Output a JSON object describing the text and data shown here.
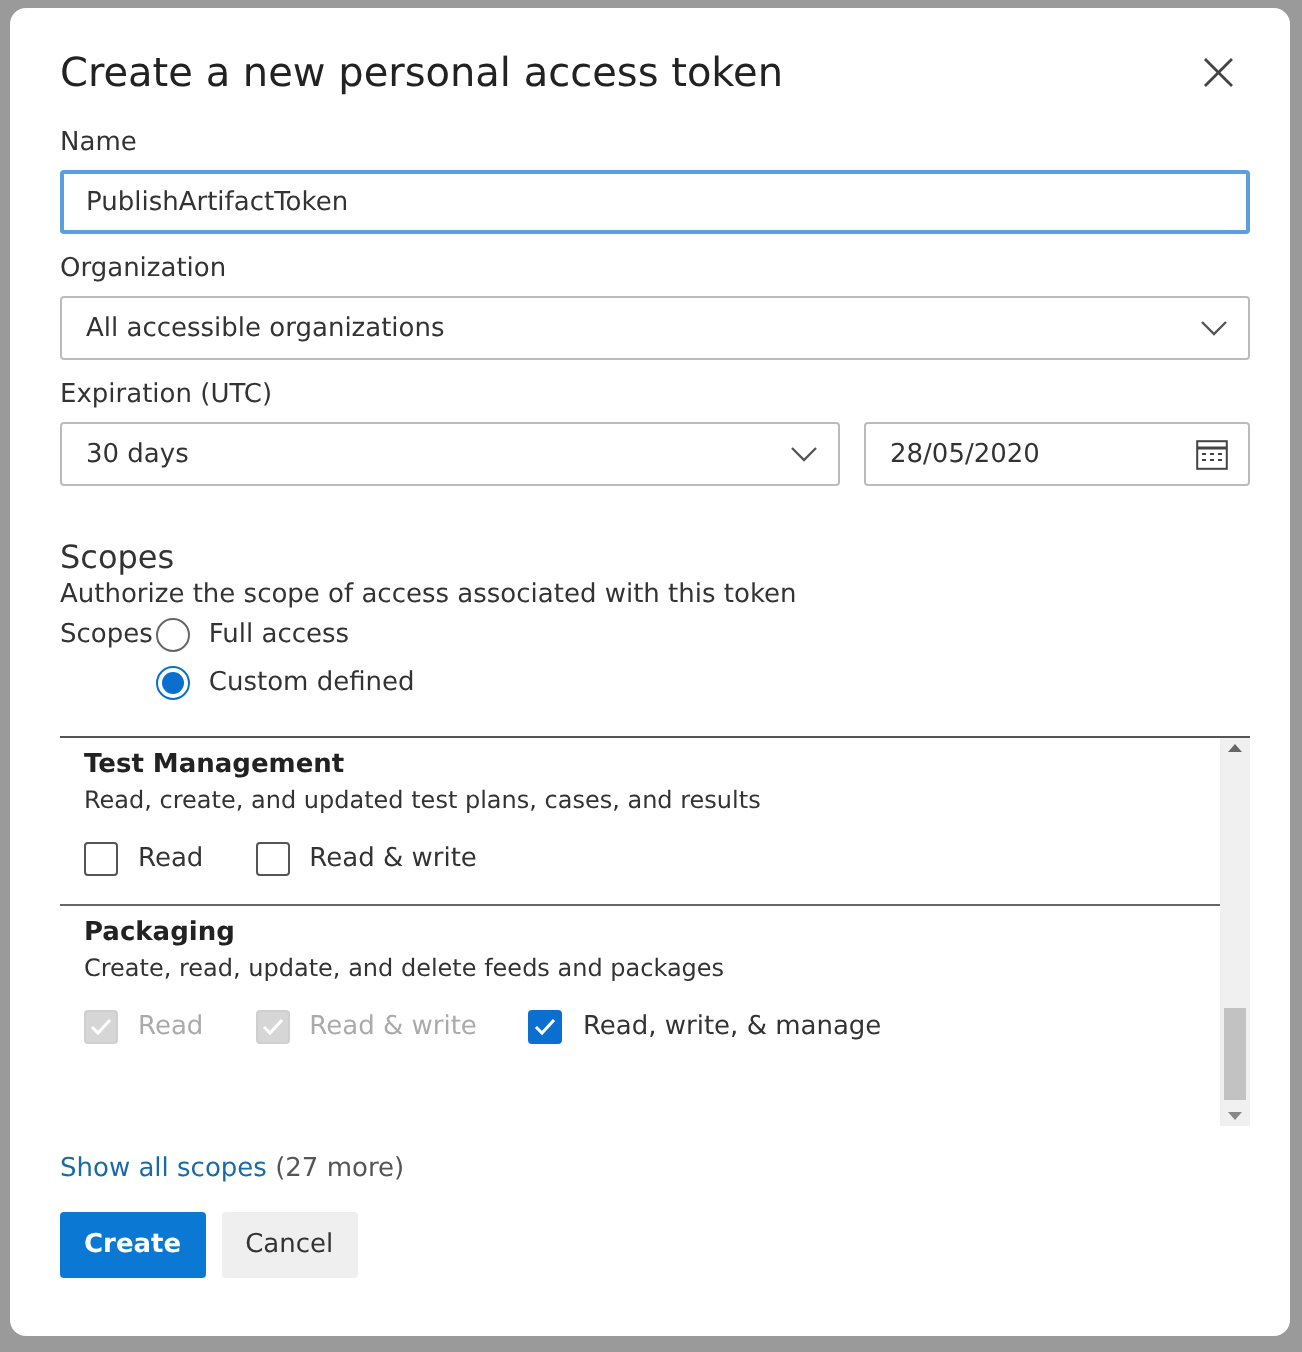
{
  "dialog": {
    "title": "Create a new personal access token",
    "close": "×"
  },
  "name": {
    "label": "Name",
    "value": "PublishArtifactToken",
    "focused": true
  },
  "organization": {
    "label": "Organization",
    "value": "All accessible organizations"
  },
  "expiration": {
    "label": "Expiration (UTC)",
    "value": "30 days",
    "date": "28/05/2020"
  },
  "scopes": {
    "heading": "Scopes",
    "description": "Authorize the scope of access associated with this token",
    "group_label": "Scopes",
    "options": [
      {
        "label": "Full access",
        "selected": false
      },
      {
        "label": "Custom defined",
        "selected": true
      }
    ],
    "sections": [
      {
        "title": "Test Management",
        "description": "Read, create, and updated test plans, cases, and results",
        "permissions": [
          {
            "label": "Read",
            "checked": false,
            "disabled": false
          },
          {
            "label": "Read & write",
            "checked": false,
            "disabled": false
          }
        ]
      },
      {
        "title": "Packaging",
        "description": "Create, read, update, and delete feeds and packages",
        "permissions": [
          {
            "label": "Read",
            "checked": true,
            "disabled": true
          },
          {
            "label": "Read & write",
            "checked": true,
            "disabled": true
          },
          {
            "label": "Read, write, & manage",
            "checked": true,
            "disabled": false
          }
        ]
      }
    ]
  },
  "show_all": {
    "link": "Show all scopes",
    "count": "(27 more)"
  },
  "buttons": [
    {
      "label": "Create",
      "kind": "primary"
    },
    {
      "label": "Cancel",
      "kind": "secondary"
    }
  ]
}
